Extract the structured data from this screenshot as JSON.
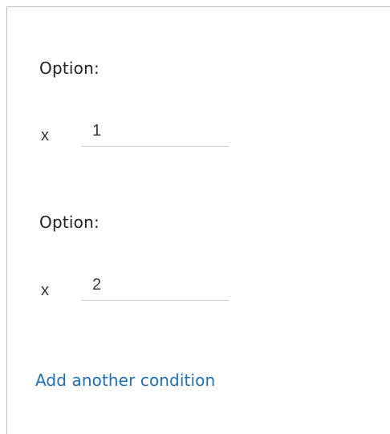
{
  "conditions": [
    {
      "label": "Option:",
      "remove_glyph": "x",
      "value": "1"
    },
    {
      "label": "Option:",
      "remove_glyph": "x",
      "value": "2"
    }
  ],
  "add_condition_label": "Add another condition",
  "colors": {
    "link": "#1f6fb2",
    "text": "#222222",
    "input_underline": "#cfcfcf"
  }
}
